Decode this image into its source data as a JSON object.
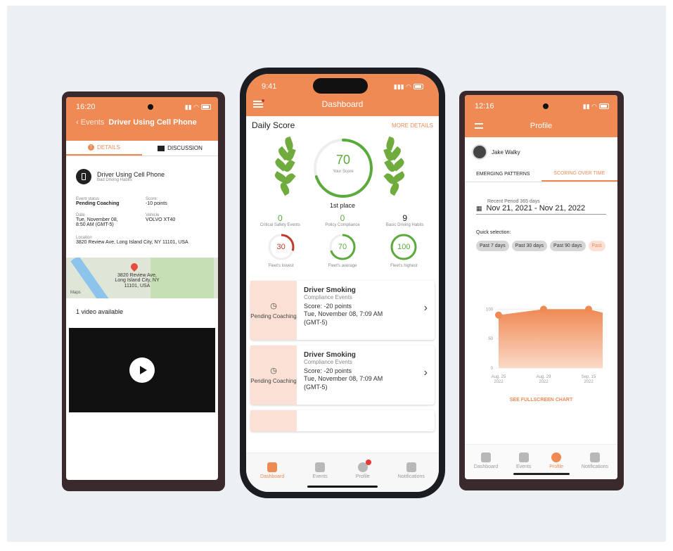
{
  "colors": {
    "accent": "#ef8a55",
    "green": "#5aaa3c",
    "red": "#c0392b",
    "pending_bg": "#fbe1d5"
  },
  "left": {
    "time": "16:20",
    "back_label": "Events",
    "title": "Driver Using Cell Phone",
    "tabs": [
      {
        "label": "DETAILS",
        "icon": "info-icon"
      },
      {
        "label": "DISCUSSION",
        "icon": "chat-icon"
      }
    ],
    "event": {
      "name": "Driver Using Cell Phone",
      "category": "Bad Driving Habits"
    },
    "fields": {
      "status_label": "Event status",
      "status_value": "Pending Coaching",
      "score_label": "Score:",
      "score_value": "-10 points",
      "date_label": "Date",
      "date_value": "Tue, November 08, 8:50 AM (GMT-5)",
      "vehicle_label": "Vehicle",
      "vehicle_value": "VOLVO XT40",
      "location_label": "Location",
      "location_value": "3820 Review Ave, Long Island City, NY 11101, USA"
    },
    "map": {
      "label": "3820 Review Ave, Long Island City, NY 11101, USA",
      "brand": "Maps"
    },
    "video_label": "1 video available"
  },
  "center": {
    "time": "9:41",
    "title": "Dashboard",
    "daily_score_label": "Daily Score",
    "more_details": "MORE DETAILS",
    "score": "70",
    "score_fraction": 0.7,
    "score_sub": "Your Score",
    "place": "1st place",
    "stats": [
      {
        "value": "0",
        "label": "Critical Safety Events"
      },
      {
        "value": "0",
        "label": "Policy Compliance"
      },
      {
        "value": "9",
        "label": "Basic Driving Habits"
      }
    ],
    "fleet": [
      {
        "value": "30",
        "label": "Fleet's lowest",
        "fraction": 0.3
      },
      {
        "value": "70",
        "label": "Fleet's average",
        "fraction": 0.7
      },
      {
        "value": "100",
        "label": "Fleet's highest",
        "fraction": 1.0
      }
    ],
    "events": [
      {
        "status": "Pending Coaching",
        "title": "Driver Smoking",
        "category": "Compliance Events",
        "score": "Score: -20 points",
        "date": "Tue, November 08, 7:09 AM (GMT-5)"
      },
      {
        "status": "Pending Coaching",
        "title": "Driver Smoking",
        "category": "Compliance Events",
        "score": "Score: -20 points",
        "date": "Tue, November 08, 7:09 AM (GMT-5)"
      }
    ],
    "tabs": [
      {
        "label": "Dashboard",
        "icon": "dashboard-icon"
      },
      {
        "label": "Events",
        "icon": "events-icon"
      },
      {
        "label": "Profile",
        "icon": "profile-icon"
      },
      {
        "label": "Notifications",
        "icon": "bell-icon"
      }
    ]
  },
  "right": {
    "time": "12:16",
    "title": "Profile",
    "user": "Jake Walky",
    "tabs": [
      "EMERGING PATTERNS",
      "SCORING OVER TIME"
    ],
    "period_label": "Recent Period 365 days",
    "period_value": "Nov 21, 2021 - Nov 21, 2022",
    "quick_label": "Quick selection:",
    "chips": [
      "Past 7 days",
      "Past 30 days",
      "Past 90 days",
      "Past"
    ],
    "fullscreen": "SEE FULLSCREEN CHART",
    "tabs_bottom": [
      {
        "label": "Dashboard",
        "icon": "dashboard-icon"
      },
      {
        "label": "Events",
        "icon": "events-icon"
      },
      {
        "label": "Profile",
        "icon": "profile-icon"
      },
      {
        "label": "Notifications",
        "icon": "bell-icon"
      }
    ]
  },
  "chart_data": {
    "type": "area",
    "x": [
      "Aug. 25 2022",
      "Aug. 29 2022",
      "Sep. 15 2022"
    ],
    "values": [
      90,
      100,
      100
    ],
    "y_ticks": [
      "100",
      "50",
      "0"
    ],
    "ylim": [
      0,
      110
    ],
    "grid": true
  }
}
